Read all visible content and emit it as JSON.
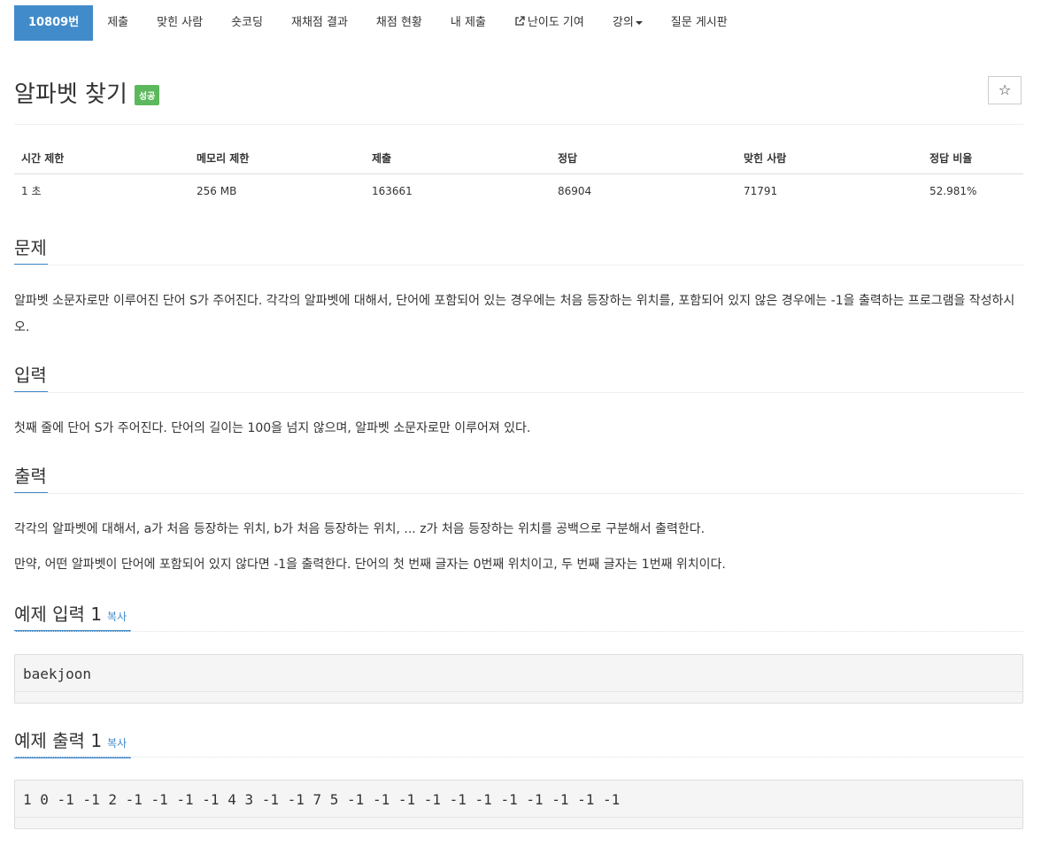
{
  "nav": {
    "items": [
      {
        "label": "10809번",
        "active": true
      },
      {
        "label": "제출"
      },
      {
        "label": "맞힌 사람"
      },
      {
        "label": "숏코딩"
      },
      {
        "label": "재채점 결과"
      },
      {
        "label": "채점 현황"
      },
      {
        "label": "내 제출"
      },
      {
        "label": "난이도 기여",
        "icon": "external-link-icon"
      },
      {
        "label": "강의",
        "icon": "caret-down-icon"
      },
      {
        "label": "질문 게시판"
      }
    ]
  },
  "problem": {
    "title": "알파벳 찾기",
    "badge": "성공",
    "star_icon": "☆"
  },
  "info": {
    "headers": [
      "시간 제한",
      "메모리 제한",
      "제출",
      "정답",
      "맞힌 사람",
      "정답 비율"
    ],
    "values": [
      "1 초",
      "256 MB",
      "163661",
      "86904",
      "71791",
      "52.981%"
    ]
  },
  "sections": {
    "problem": {
      "heading": "문제",
      "text": "알파벳 소문자로만 이루어진 단어 S가 주어진다. 각각의 알파벳에 대해서, 단어에 포함되어 있는 경우에는 처음 등장하는 위치를, 포함되어 있지 않은 경우에는 -1을 출력하는 프로그램을 작성하시오."
    },
    "input": {
      "heading": "입력",
      "text": "첫째 줄에 단어 S가 주어진다. 단어의 길이는 100을 넘지 않으며, 알파벳 소문자로만 이루어져 있다."
    },
    "output": {
      "heading": "출력",
      "text1": "각각의 알파벳에 대해서, a가 처음 등장하는 위치, b가 처음 등장하는 위치, ... z가 처음 등장하는 위치를 공백으로 구분해서 출력한다.",
      "text2": "만약, 어떤 알파벳이 단어에 포함되어 있지 않다면 -1을 출력한다. 단어의 첫 번째 글자는 0번째 위치이고, 두 번째 글자는 1번째 위치이다."
    },
    "sample_input": {
      "heading": "예제 입력 1",
      "copy": "복사",
      "content": "baekjoon"
    },
    "sample_output": {
      "heading": "예제 출력 1",
      "copy": "복사",
      "content": "1 0 -1 -1 2 -1 -1 -1 -1 4 3 -1 -1 7 5 -1 -1 -1 -1 -1 -1 -1 -1 -1 -1 -1"
    }
  },
  "colors": {
    "accent": "#428bca",
    "success": "#5cb85c"
  }
}
